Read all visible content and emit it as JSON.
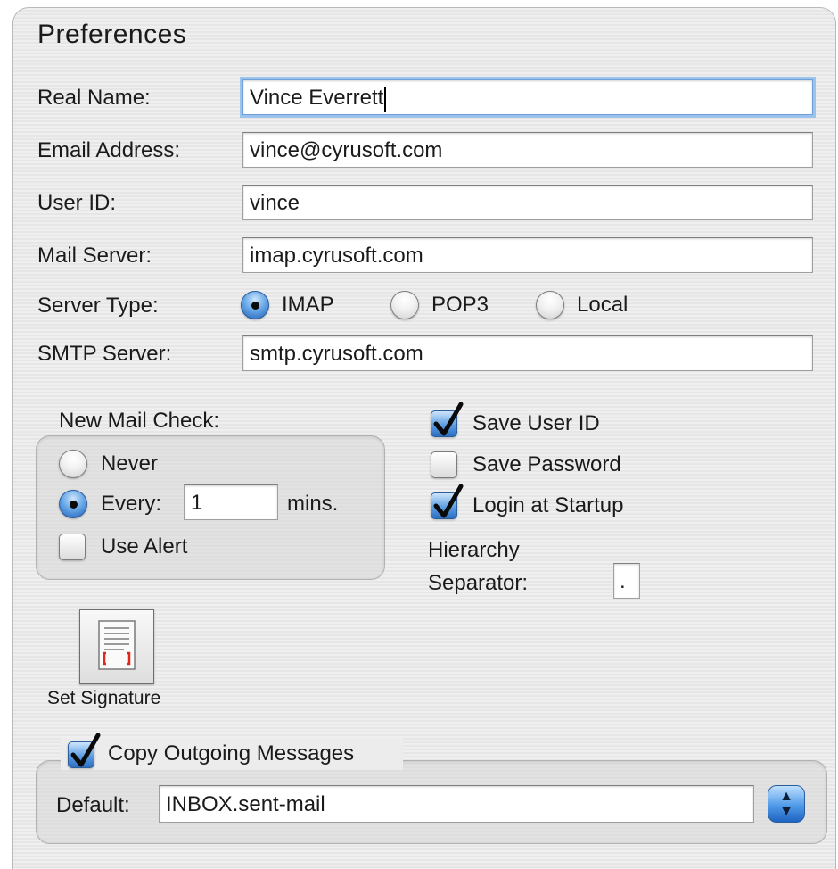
{
  "window": {
    "title": "Preferences"
  },
  "account": {
    "real_name": {
      "label": "Real Name:",
      "value": "Vince Everrett"
    },
    "email": {
      "label": "Email Address:",
      "value": "vince@cyrusoft.com"
    },
    "user_id": {
      "label": "User ID:",
      "value": "vince"
    },
    "mail_server": {
      "label": "Mail Server:",
      "value": "imap.cyrusoft.com"
    },
    "server_type": {
      "label": "Server Type:",
      "options": [
        {
          "label": "IMAP",
          "selected": true
        },
        {
          "label": "POP3",
          "selected": false
        },
        {
          "label": "Local",
          "selected": false
        }
      ]
    },
    "smtp_server": {
      "label": "SMTP Server:",
      "value": "smtp.cyrusoft.com"
    }
  },
  "new_mail_check": {
    "label": "New Mail Check:",
    "never_label": "Never",
    "every_label": "Every:",
    "every_value": "1",
    "mins_label": "mins.",
    "selected": "Every",
    "use_alert_label": "Use Alert",
    "use_alert_checked": false
  },
  "options": {
    "save_user_id": {
      "label": "Save User ID",
      "checked": true
    },
    "save_password": {
      "label": "Save Password",
      "checked": false
    },
    "login_at_startup": {
      "label": "Login at Startup",
      "checked": true
    },
    "hierarchy_label_line1": "Hierarchy",
    "hierarchy_label_line2": "Separator:",
    "hierarchy_value": "."
  },
  "signature": {
    "label": "Set Signature",
    "icon": "signature-document-icon"
  },
  "copy_outgoing": {
    "label": "Copy Outgoing Messages",
    "checked": true,
    "default_label": "Default:",
    "default_value": "INBOX.sent-mail",
    "popup_icon": "up-down-arrows-icon"
  },
  "colors": {
    "accent": "#2c6ec0",
    "focus_ring": "#9cc3ee",
    "window_bg": "#ececec"
  }
}
